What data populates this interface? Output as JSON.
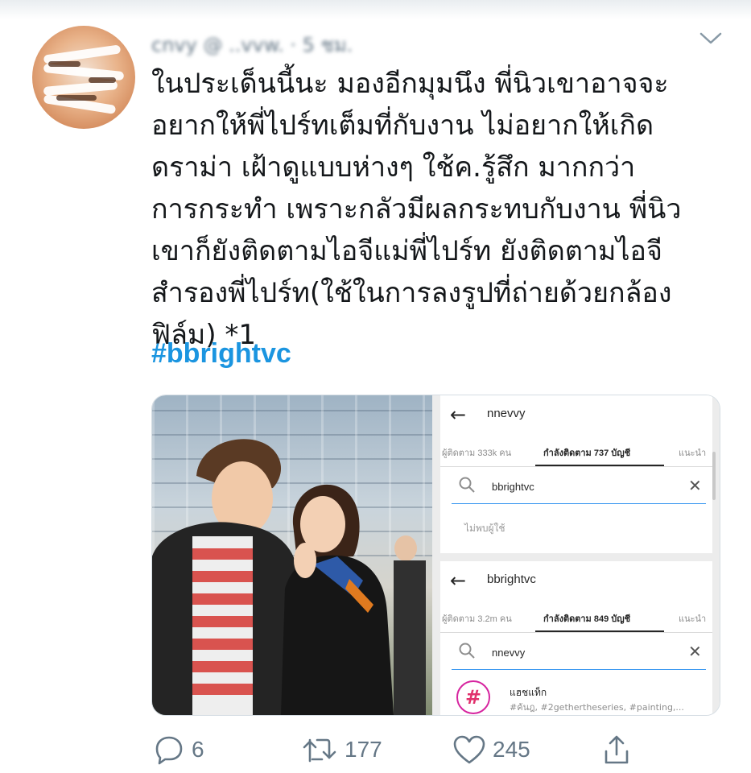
{
  "header": {
    "redacted_text": "cnvy @ ..vvw. · 5 ชม."
  },
  "tweet": {
    "text": "ในประเด็นนี้นะ มองอีกมุมนึง พี่นิวเขาอาจจะ\nอยากให้พี่ไปร์ทเต็มที่กับงาน ไม่อยากให้เกิด\nดราม่า เฝ้าดูแบบห่างๆ ใช้ค.รู้สึก มากกว่า\nการกระทำ เพราะกลัวมีผลกระทบกับงาน พี่นิว\nเขาก็ยังติดตามไอจีแม่พี่ไปร์ท ยังติดตามไอจี\nสำรองพี่ไปร์ท(ใช้ในการลงรูปที่ถ่ายด้วยกล้อง\nฟิล์ม) *1",
    "hashtag": "#bbrightvc"
  },
  "screens": {
    "panel1": {
      "username": "nnevvy",
      "tab_followers": "ผู้ติดตาม 333k คน",
      "tab_following": "กำลังติดตาม 737 บัญชี",
      "tab_suggested": "แนะนำ",
      "query": "bbrightvc",
      "no_result": "ไม่พบผู้ใช้"
    },
    "panel2": {
      "username": "bbrightvc",
      "tab_followers": "ผู้ติดตาม 3.2m คน",
      "tab_following": "กำลังติดตาม 849 บัญชี",
      "tab_suggested": "แนะนำ",
      "query": "nnevvy",
      "result_title": "แฮชแท็ก",
      "result_sub": "#ค้นฎ, #2gethertheseries, #painting,..."
    }
  },
  "actions": {
    "reply_count": "6",
    "retweet_count": "177",
    "like_count": "245"
  },
  "colors": {
    "hashtag": "#1b95e0",
    "action_gray": "#657786"
  },
  "icons": [
    "reply-icon",
    "retweet-icon",
    "like-icon",
    "share-icon",
    "chevron-down-icon",
    "search-icon",
    "back-arrow-icon",
    "clear-icon",
    "hashtag-icon"
  ]
}
